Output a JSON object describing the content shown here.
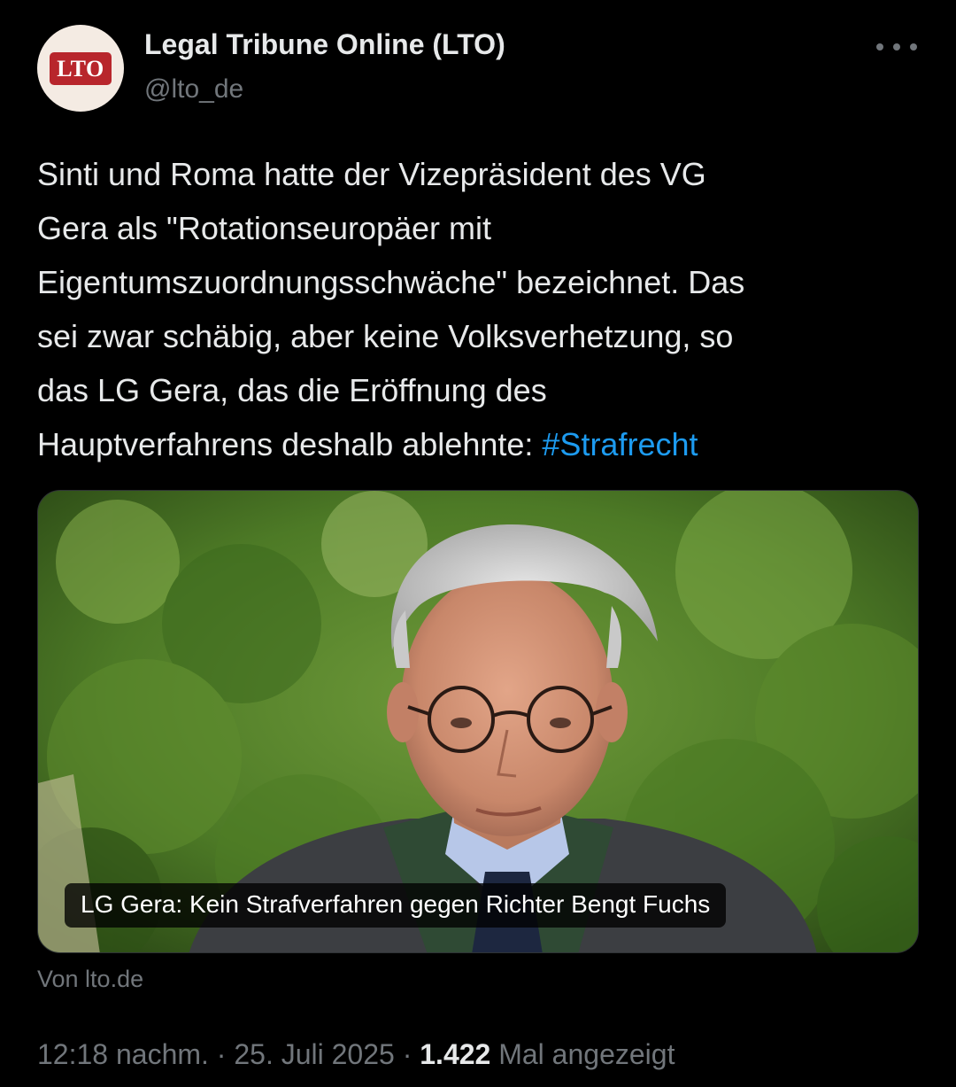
{
  "author": {
    "display_name": "Legal Tribune Online (LTO)",
    "handle": "@lto_de",
    "avatar_logo_text": "LTO",
    "avatar_icon": "lto-logo-icon",
    "more_icon": "more-dots-icon"
  },
  "tweet": {
    "lines": [
      "Sinti und Roma hatte der Vizepräsident des VG",
      "Gera als \"Rotationseuropäer mit",
      "Eigentumszuordnungsschwäche\" bezeichnet. Das",
      "sei zwar schäbig, aber keine Volksverhetzung, so",
      "das LG Gera, das die Eröffnung des",
      "Hauptverfahrens deshalb ablehnte: "
    ],
    "hashtag": "#Strafrecht"
  },
  "card": {
    "caption": "LG Gera: Kein Strafverfahren gegen Richter Bengt Fuchs",
    "source": "Von lto.de"
  },
  "meta": {
    "time": "12:18 nachm.",
    "separator": "·",
    "date": "25. Juli 2025",
    "views_count": "1.422",
    "views_label": "Mal angezeigt"
  },
  "colors": {
    "background": "#000000",
    "text": "#e7e9ea",
    "secondary": "#71767b",
    "link": "#1d9bf0",
    "brand_red": "#b8262c"
  }
}
